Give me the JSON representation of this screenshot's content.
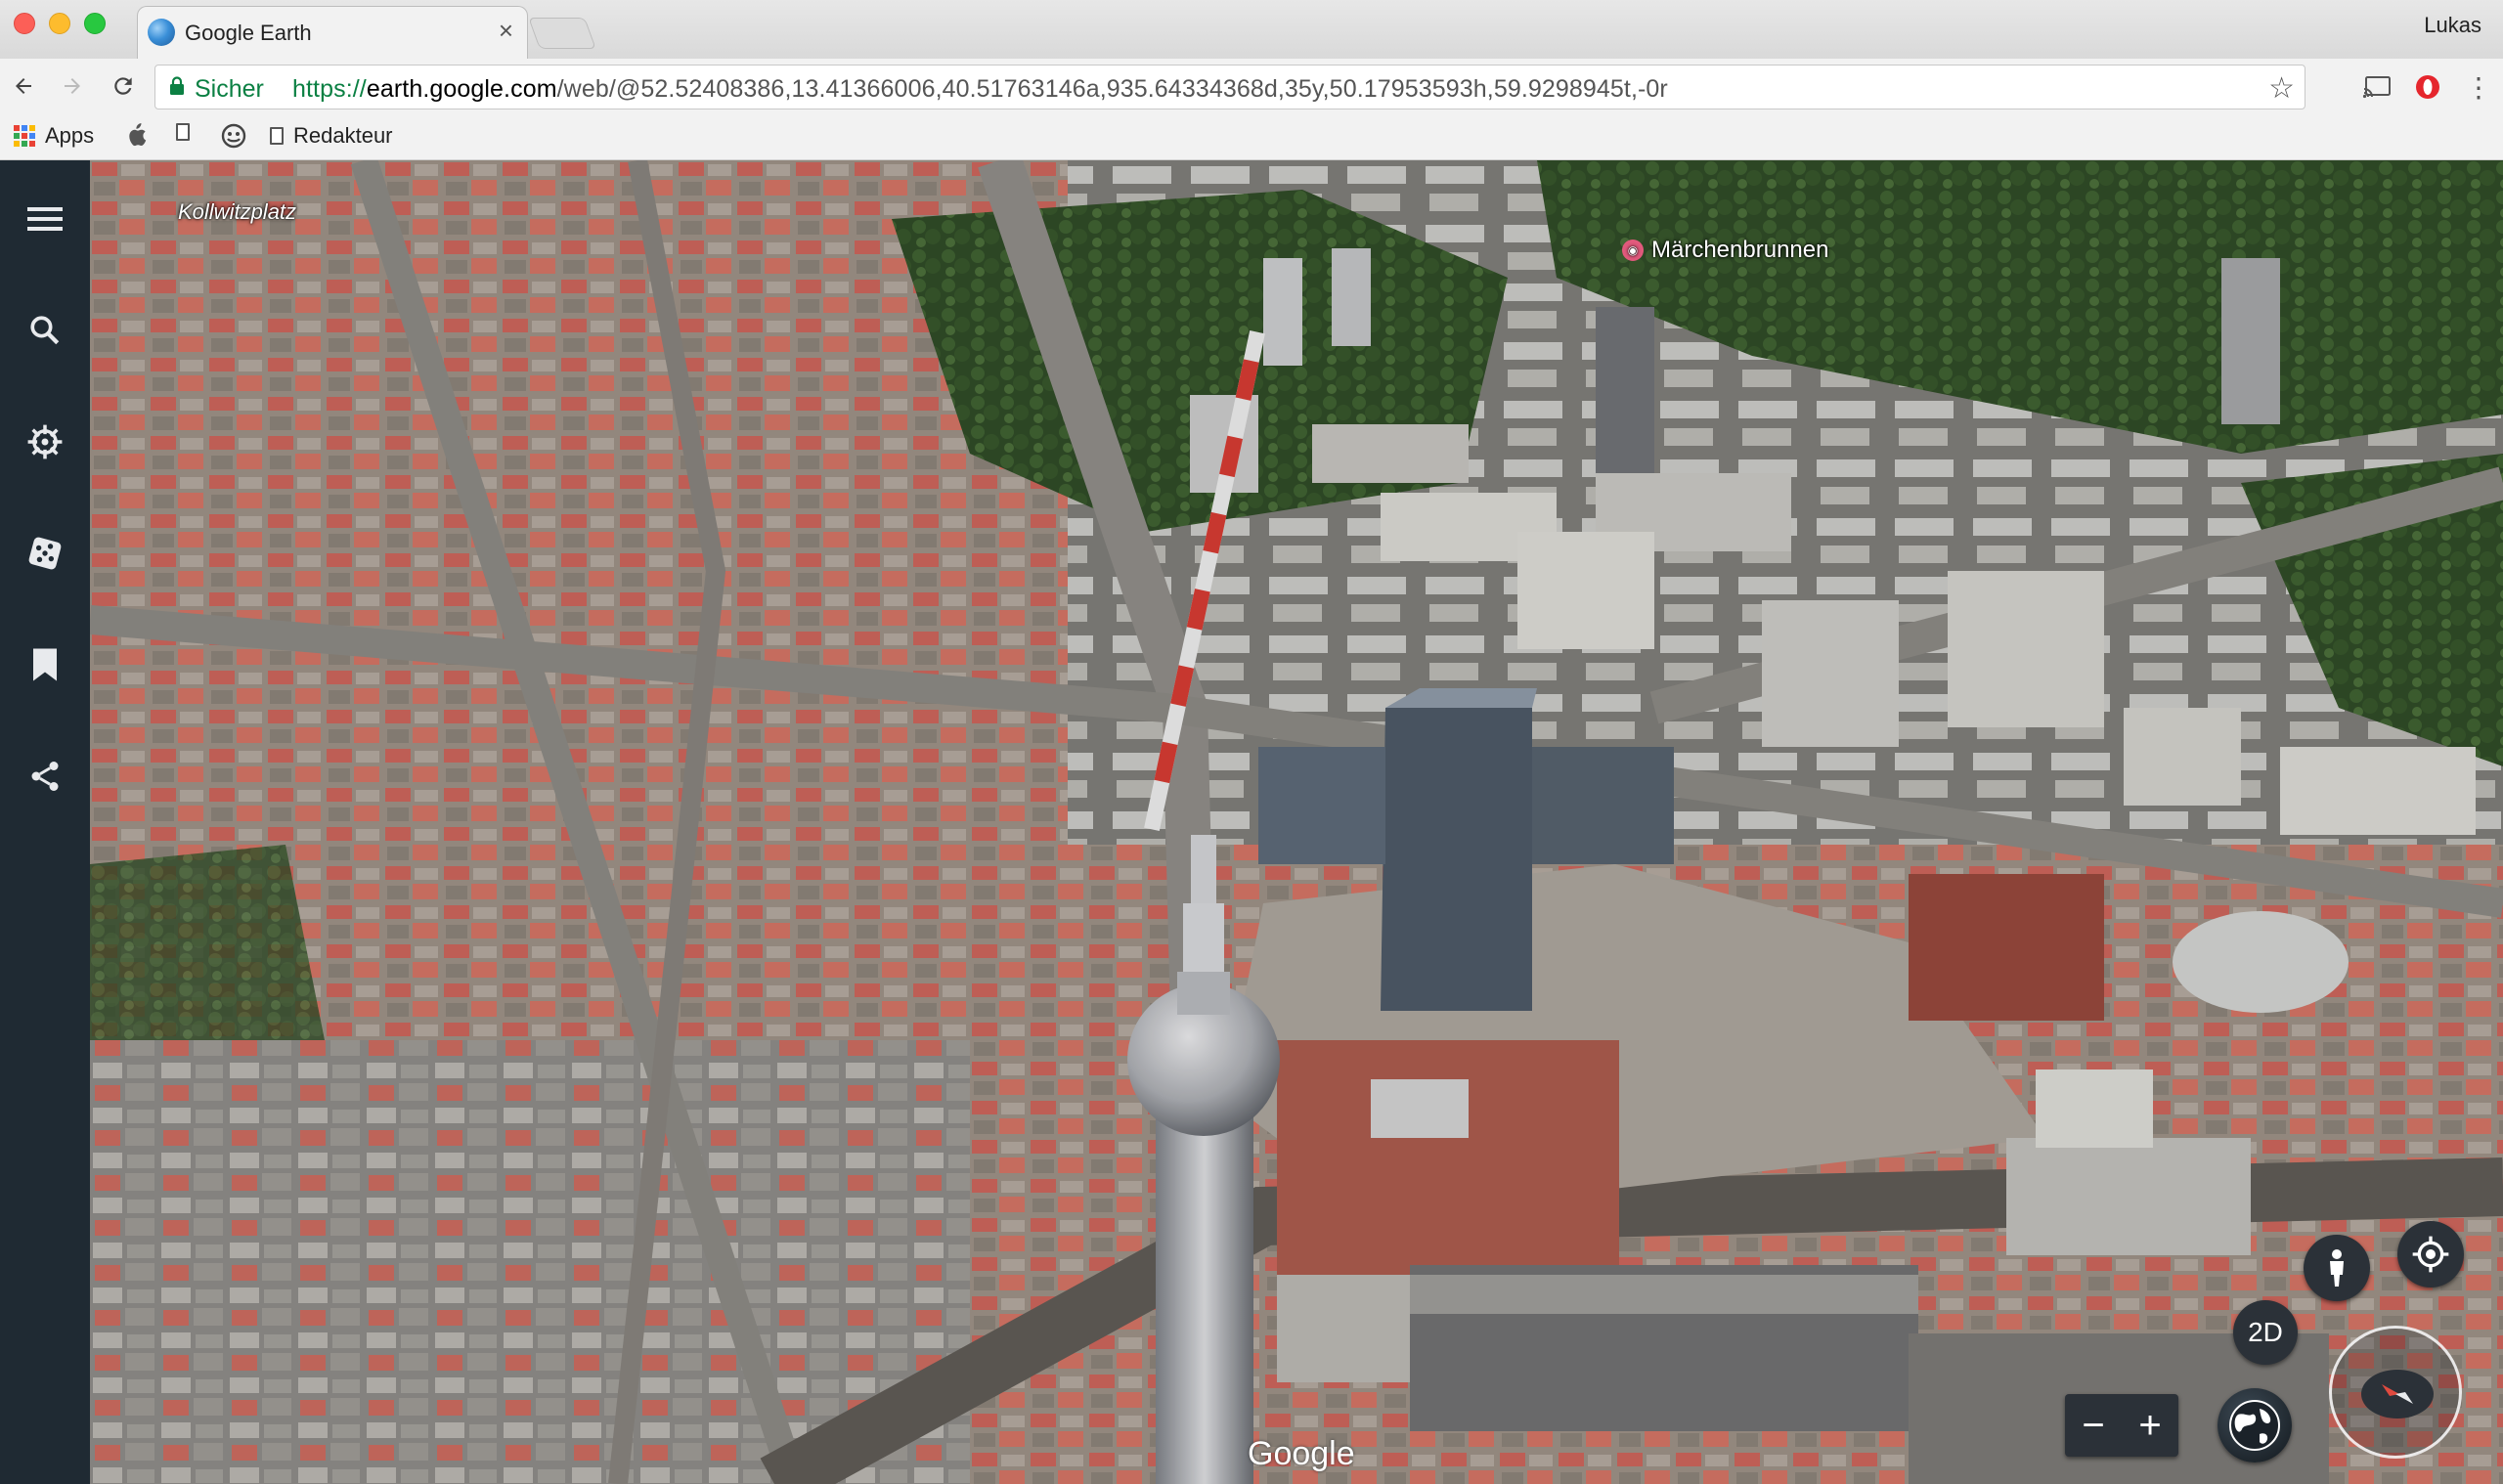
{
  "browser": {
    "tab_title": "Google Earth",
    "profile_name": "Lukas",
    "secure_label": "Sicher",
    "url_protocol": "https://",
    "url_host": "earth.google.com",
    "url_path": "/web/@52.52408386,13.41366006,40.51763146a,935.64334368d,35y,50.17953593h,59.9298945t,-0r",
    "bookmarks": {
      "apps": "Apps",
      "redakteur": "Redakteur"
    }
  },
  "map": {
    "labels": {
      "kollwitzplatz": "Kollwitzplatz",
      "maerchenbrunnen": "Märchenbrunnen"
    },
    "attribution": "Google"
  },
  "controls": {
    "view_toggle": "2D",
    "zoom_out": "−",
    "zoom_in": "+"
  },
  "colors": {
    "sidebar_bg": "#1f2a33",
    "secure_green": "#0b8043",
    "control_bg": "#2b3138"
  },
  "icons": {
    "sidebar": [
      "menu-icon",
      "search-icon",
      "voyager-wheel-icon",
      "feeling-lucky-dice-icon",
      "projects-bookmark-icon",
      "share-icon"
    ],
    "map_controls": [
      "pegman-icon",
      "my-location-icon",
      "compass-icon",
      "globe-icon"
    ]
  }
}
